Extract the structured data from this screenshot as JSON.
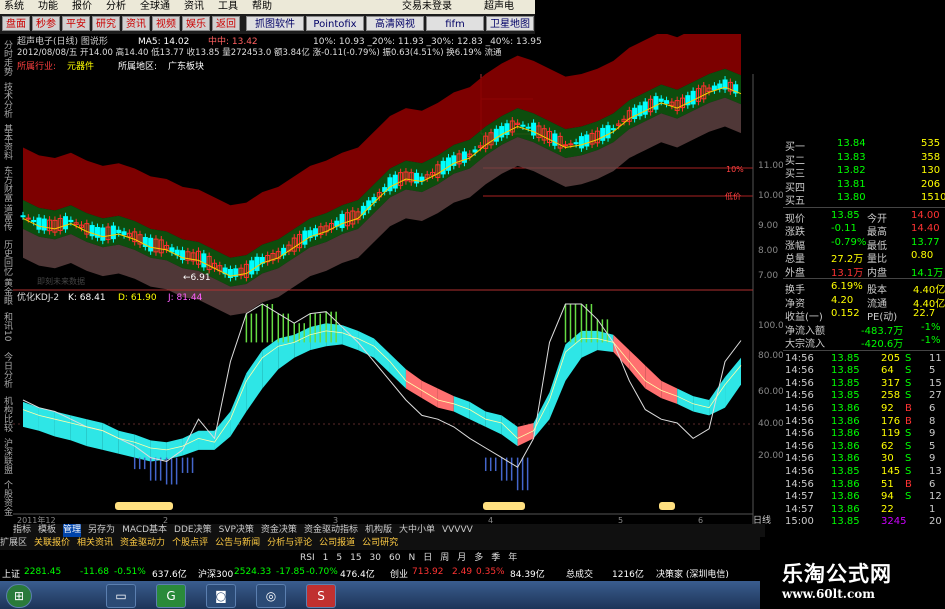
{
  "menu": {
    "items": [
      "系统",
      "功能",
      "报价",
      "分析",
      "全球通",
      "资讯",
      "工具",
      "帮助"
    ],
    "login": "交易未登录",
    "app_name": "超声电子"
  },
  "toolbar": {
    "buttons": [
      "盘面",
      "秒参",
      "平安",
      "研究",
      "资讯",
      "视频",
      "娱乐",
      "返回"
    ],
    "wide_buttons": [
      "抓图软件",
      "Pointofix",
      "高清网视",
      "fifm",
      "卫星地图"
    ]
  },
  "side_labels": [
    "分时走势",
    "技术分析",
    "基本资料",
    "东方财富",
    "道富传",
    "历史回忆",
    "黄金眼",
    "和讯10",
    "今日分析",
    "机构比较",
    "沪深联盟",
    "个股资金"
  ],
  "chart_header": {
    "title": "超声电子(日线) 图说形",
    "ma": "MA5: 14.02",
    "ma2": "中中: 13.42",
    "pct_levels": "10%: 10.93  _20%: 11.93  _30%: 12.83  _40%: 13.95",
    "date_line": "2012/08/08/五 开14.00 高14.40 低13.77 收13.85 量272453.0 额3.84亿 涨-0.11(-0.79%) 振0.63(4.51%) 换6.19% 流通",
    "industry_label": "所属行业:",
    "industry": "元器件",
    "region_label": "所属地区:",
    "region": "广东板块",
    "low_marker": "←6.91",
    "note": "即刻未来数据",
    "pct_right": "10%",
    "low_price_label": "低价"
  },
  "indicator": {
    "label": "优化KDJ-2",
    "k": "K: 68.41",
    "d": "D: 61.90",
    "j": "J: 81.44"
  },
  "axis": {
    "price_ticks": [
      "11.00",
      "10.00",
      "9.00",
      "8.00",
      "7.00"
    ],
    "kdj_ticks": [
      "100.00",
      "80.00",
      "60.00",
      "40.00",
      "20.00"
    ],
    "dates": [
      "2011年12",
      "2",
      "3",
      "4",
      "5",
      "6"
    ],
    "day_label": "日线"
  },
  "chart_data": {
    "type": "line",
    "price_range": [
      6.5,
      14.5
    ],
    "price": [
      9.1,
      8.8,
      8.7,
      8.9,
      8.6,
      8.4,
      8.5,
      8.3,
      8.0,
      7.9,
      7.6,
      7.5,
      7.2,
      6.9,
      7.0,
      7.4,
      7.6,
      8.0,
      8.4,
      8.6,
      8.9,
      9.1,
      9.7,
      10.3,
      10.6,
      10.5,
      10.8,
      11.2,
      11.4,
      11.9,
      12.3,
      12.6,
      12.4,
      12.1,
      11.8,
      11.9,
      12.1,
      12.4,
      12.9,
      13.2,
      13.5,
      13.3,
      13.6,
      13.9,
      14.1,
      13.85
    ],
    "kdj_range": [
      0,
      100
    ],
    "k": [
      45,
      42,
      40,
      38,
      36,
      34,
      30,
      28,
      25,
      24,
      26,
      30,
      28,
      40,
      60,
      72,
      78,
      80,
      84,
      86,
      85,
      82,
      78,
      70,
      60,
      55,
      50,
      48,
      45,
      40,
      38,
      30,
      34,
      50,
      75,
      82,
      82,
      80,
      70,
      60,
      55,
      52,
      48,
      46,
      58,
      68
    ],
    "d": [
      40,
      38,
      35,
      33,
      30,
      28,
      26,
      24,
      22,
      23,
      25,
      28,
      30,
      35,
      48,
      60,
      70,
      76,
      80,
      82,
      83,
      80,
      76,
      68,
      62,
      56,
      52,
      48,
      44,
      40,
      36,
      32,
      34,
      44,
      64,
      76,
      80,
      79,
      72,
      64,
      56,
      52,
      48,
      46,
      50,
      62
    ],
    "j": [
      50,
      46,
      44,
      40,
      36,
      34,
      30,
      26,
      20,
      18,
      24,
      40,
      30,
      70,
      95,
      100,
      95,
      90,
      95,
      96,
      88,
      80,
      70,
      60,
      50,
      42,
      40,
      36,
      30,
      25,
      20,
      15,
      30,
      80,
      100,
      100,
      92,
      80,
      60,
      45,
      40,
      38,
      30,
      35,
      70,
      81
    ]
  },
  "quote": {
    "bids": [
      {
        "label": "买一",
        "price": "13.84",
        "vol": "535"
      },
      {
        "label": "买二",
        "price": "13.83",
        "vol": "358"
      },
      {
        "label": "买三",
        "price": "13.82",
        "vol": "130"
      },
      {
        "label": "买四",
        "price": "13.81",
        "vol": "206"
      },
      {
        "label": "买五",
        "price": "13.80",
        "vol": "1510"
      }
    ],
    "stats": [
      {
        "l1": "现价",
        "v1": "13.85",
        "l2": "今开",
        "v2": "14.00"
      },
      {
        "l1": "涨跌",
        "v1": "-0.11",
        "l2": "最高",
        "v2": "14.40"
      },
      {
        "l1": "涨幅",
        "v1": "-0.79%",
        "l2": "最低",
        "v2": "13.77"
      },
      {
        "l1": "总量",
        "v1": "27.2万",
        "l2": "量比",
        "v2": "0.80"
      },
      {
        "l1": "外盘",
        "v1": "13.1万",
        "l2": "内盘",
        "v2": "14.1万"
      }
    ],
    "fund": [
      {
        "l1": "换手",
        "v1": "6.19%",
        "l2": "股本",
        "v2": "4.40亿"
      },
      {
        "l1": "净资",
        "v1": "4.20",
        "l2": "流通",
        "v2": "4.40亿"
      },
      {
        "l1": "收益(一)",
        "v1": "0.152",
        "l2": "PE(动)",
        "v2": "22.7"
      }
    ],
    "flow": [
      {
        "l": "净流入额",
        "v": "-483.7万",
        "p": "-1%"
      },
      {
        "l": "大宗流入",
        "v": "-420.6万",
        "p": "-1%"
      }
    ],
    "ticks": [
      {
        "t": "14:56",
        "p": "13.85",
        "v": "205",
        "s": "S",
        "n": "11"
      },
      {
        "t": "14:56",
        "p": "13.85",
        "v": "64",
        "s": "S",
        "n": "5"
      },
      {
        "t": "14:56",
        "p": "13.85",
        "v": "317",
        "s": "S",
        "n": "15"
      },
      {
        "t": "14:56",
        "p": "13.85",
        "v": "258",
        "s": "S",
        "n": "27"
      },
      {
        "t": "14:56",
        "p": "13.86",
        "v": "92",
        "s": "B",
        "n": "6"
      },
      {
        "t": "14:56",
        "p": "13.86",
        "v": "176",
        "s": "B",
        "n": "8"
      },
      {
        "t": "14:56",
        "p": "13.86",
        "v": "119",
        "s": "S",
        "n": "9"
      },
      {
        "t": "14:56",
        "p": "13.86",
        "v": "62",
        "s": "S",
        "n": "5"
      },
      {
        "t": "14:56",
        "p": "13.86",
        "v": "30",
        "s": "S",
        "n": "9"
      },
      {
        "t": "14:56",
        "p": "13.85",
        "v": "145",
        "s": "S",
        "n": "13"
      },
      {
        "t": "14:56",
        "p": "13.86",
        "v": "51",
        "s": "B",
        "n": "6"
      },
      {
        "t": "14:57",
        "p": "13.86",
        "v": "94",
        "s": "S",
        "n": "12"
      },
      {
        "t": "14:57",
        "p": "13.86",
        "v": "22",
        "s": "",
        "n": "1"
      },
      {
        "t": "15:00",
        "p": "13.85",
        "v": "3245",
        "s": "",
        "n": "20"
      }
    ]
  },
  "bottom_tabs": [
    "指标",
    "模板",
    "管理",
    "另存为",
    "MACD基本",
    "DDE决策",
    "SVP决策",
    "资金决策",
    "资金驱动指标",
    "机构版",
    "大中小单",
    "VVVVV"
  ],
  "bottom_tabs2": [
    "扩展区",
    "关联报价",
    "相关资讯",
    "资金驱动力",
    "个股点评",
    "公告与新闻",
    "分析与评论",
    "公司报道",
    "公司研究"
  ],
  "periods": [
    "RSI",
    "1",
    "5",
    "15",
    "30",
    "60",
    "N",
    "日",
    "周",
    "月",
    "多",
    "季",
    "年"
  ],
  "status_bar": {
    "sh_label": "上证",
    "sh_val": "2281.45",
    "sh_chg": "-11.68",
    "sh_pct": "-0.51%",
    "sh_amt": "637.6亿",
    "hs_label": "沪深300",
    "hs_val": "2524.33",
    "hs_chg": "-17.85",
    "hs_pct": "-0.70%",
    "hs_amt": "476.4亿",
    "cy_label": "创业",
    "cy_val": "713.92",
    "cy_chg": "2.49",
    "cy_pct": "0.35%",
    "cy_amt": "84.39亿",
    "total_label": "总成交",
    "total_val": "1216亿",
    "server": "决策家 (深圳电信)"
  },
  "brand": {
    "name": "乐淘公式网",
    "url": "www.60lt.com"
  },
  "colors": {
    "up": "#ff3030",
    "down": "#00ffff",
    "ma": "#ffff00",
    "band_red": "#8b0000",
    "band_green": "#0f5a0f",
    "kdj_cyan": "#2ee6e6",
    "kdj_red": "#ff7070",
    "kdj_green": "#66dd44",
    "kdj_blue": "#4466cc"
  }
}
